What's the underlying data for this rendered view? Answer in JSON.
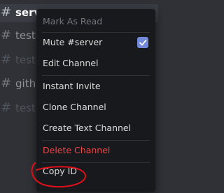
{
  "channels": [
    {
      "name": "server",
      "state": "active"
    },
    {
      "name": "test-",
      "state": "normal"
    },
    {
      "name": "test",
      "state": "dim"
    },
    {
      "name": "githu",
      "state": "normal"
    },
    {
      "name": "test-",
      "state": "dim"
    }
  ],
  "hash_symbol": "#",
  "channel_icons": "✱ ⚙",
  "menu": {
    "mark_as_read": "Mark As Read",
    "mute": "Mute #server",
    "mute_checked": true,
    "edit_channel": "Edit Channel",
    "instant_invite": "Instant Invite",
    "clone_channel": "Clone Channel",
    "create_text_channel": "Create Text Channel",
    "delete_channel": "Delete Channel",
    "copy_id": "Copy ID"
  },
  "colors": {
    "checkbox": "#7289da",
    "danger": "#f04747",
    "annotation": "#e0101a"
  }
}
